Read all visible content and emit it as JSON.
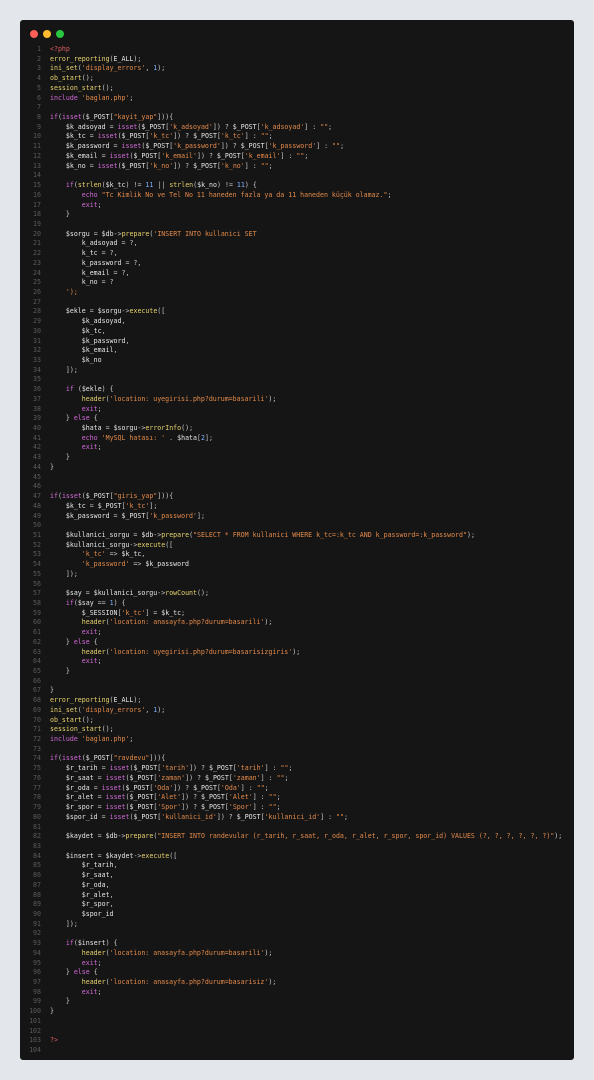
{
  "window": {
    "controls": [
      "close",
      "minimize",
      "maximize"
    ]
  },
  "editor": {
    "language": "php",
    "lines": [
      "<?php",
      "error_reporting(E_ALL);",
      "ini_set('display_errors', 1);",
      "ob_start();",
      "session_start();",
      "include 'baglan.php';",
      "",
      "if(isset($_POST[\"kayit_yap\"])){",
      "    $k_adsoyad = isset($_POST['k_adsoyad']) ? $_POST['k_adsoyad'] : \"\";",
      "    $k_tc = isset($_POST['k_tc']) ? $_POST['k_tc'] : \"\";",
      "    $k_password = isset($_POST['k_password']) ? $_POST['k_password'] : \"\";",
      "    $k_email = isset($_POST['k_email']) ? $_POST['k_email'] : \"\";",
      "    $k_no = isset($_POST['k_no']) ? $_POST['k_no'] : \"\";",
      "",
      "    if(strlen($k_tc) != 11 || strlen($k_no) != 11) {",
      "        echo \"Tc Kimlik No ve Tel No 11 haneden fazla ya da 11 haneden küçük olamaz.\";",
      "        exit;",
      "    }",
      "",
      "    $sorgu = $db->prepare('INSERT INTO kullanici SET",
      "        k_adsoyad = ?,",
      "        k_tc = ?,",
      "        k_password = ?,",
      "        k_email = ?,",
      "        k_no = ?",
      "    ');",
      "",
      "    $ekle = $sorgu->execute([",
      "        $k_adsoyad,",
      "        $k_tc,",
      "        $k_password,",
      "        $k_email,",
      "        $k_no",
      "    ]);",
      "",
      "    if ($ekle) {",
      "        header('location: uyegirisi.php?durum=basarili');",
      "        exit;",
      "    } else {",
      "        $hata = $sorgu->errorInfo();",
      "        echo 'MySQL hatası: ' . $hata[2];",
      "        exit;",
      "    }",
      "}",
      "",
      "",
      "if(isset($_POST[\"giris_yap\"])){",
      "    $k_tc = $_POST['k_tc'];",
      "    $k_password = $_POST['k_password'];",
      "",
      "    $kullanici_sorgu = $db->prepare(\"SELECT * FROM kullanici WHERE k_tc=:k_tc AND k_password=:k_password\");",
      "    $kullanici_sorgu->execute([",
      "        'k_tc' => $k_tc,",
      "        'k_password' => $k_password",
      "    ]);",
      "",
      "    $say = $kullanici_sorgu->rowCount();",
      "    if($say == 1) {",
      "        $_SESSION['k_tc'] = $k_tc;",
      "        header('location: anasayfa.php?durum=basarili');",
      "        exit;",
      "    } else {",
      "        header('location: uyegirisi.php?durum=basarisizgiris');",
      "        exit;",
      "    }",
      "",
      "}",
      "error_reporting(E_ALL);",
      "ini_set('display_errors', 1);",
      "ob_start();",
      "session_start();",
      "include 'baglan.php';",
      "",
      "if(isset($_POST[\"ravdevu\"])){",
      "    $r_tarih = isset($_POST['tarih']) ? $_POST['tarih'] : \"\";",
      "    $r_saat = isset($_POST['zaman']) ? $_POST['zaman'] : \"\";",
      "    $r_oda = isset($_POST['Oda']) ? $_POST['Oda'] : \"\";",
      "    $r_alet = isset($_POST['Alet']) ? $_POST['Alet'] : \"\";",
      "    $r_spor = isset($_POST['Spor']) ? $_POST['Spor'] : \"\";",
      "    $spor_id = isset($_POST['kullanici_id']) ? $_POST['kullanici_id'] : \"\";",
      "",
      "    $kaydet = $db->prepare(\"INSERT INTO randevular (r_tarih, r_saat, r_oda, r_alet, r_spor, spor_id) VALUES (?, ?, ?, ?, ?, ?)\");",
      "",
      "    $insert = $kaydet->execute([",
      "        $r_tarih,",
      "        $r_saat,",
      "        $r_oda,",
      "        $r_alet,",
      "        $r_spor,",
      "        $spor_id",
      "    ]);",
      "",
      "    if($insert) {",
      "        header('location: anasayfa.php?durum=basarili');",
      "        exit;",
      "    } else {",
      "        header('location: anasayfa.php?durum=basarisiz');",
      "        exit;",
      "    }",
      "}",
      "",
      "",
      "?>",
      ""
    ]
  },
  "colors": {
    "window_bg": "#151515",
    "page_bg": "#e3e6ea",
    "line_number": "#5a5a5a",
    "keyword": "#d26ad9",
    "function": "#e8d36c",
    "string": "#e38a4a",
    "variable": "#e6e6e6",
    "number": "#7fb0ff",
    "php_tag": "#e05d5d"
  }
}
